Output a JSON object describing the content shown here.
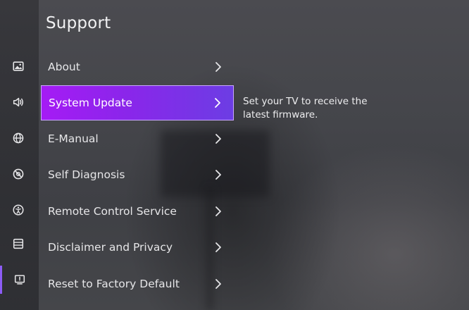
{
  "page": {
    "title": "Support"
  },
  "rail": {
    "items": [
      {
        "icon": "picture-icon",
        "active": false
      },
      {
        "icon": "sound-icon",
        "active": false
      },
      {
        "icon": "network-icon",
        "active": false
      },
      {
        "icon": "general-icon",
        "active": false
      },
      {
        "icon": "accessibility-icon",
        "active": false
      },
      {
        "icon": "list-icon",
        "active": false
      },
      {
        "icon": "support-icon",
        "active": true
      }
    ],
    "accent_color": "#8d5cf6"
  },
  "menu": {
    "items": [
      {
        "label": "About"
      },
      {
        "label": "System Update",
        "selected": true
      },
      {
        "label": "E-Manual"
      },
      {
        "label": "Self Diagnosis"
      },
      {
        "label": "Remote Control Service"
      },
      {
        "label": "Disclaimer and Privacy"
      },
      {
        "label": "Reset to Factory Default"
      }
    ]
  },
  "description": {
    "text": "Set your TV to receive the latest firmware."
  },
  "colors": {
    "selection_start": "#a51bf5",
    "selection_end": "#6c3de4"
  }
}
